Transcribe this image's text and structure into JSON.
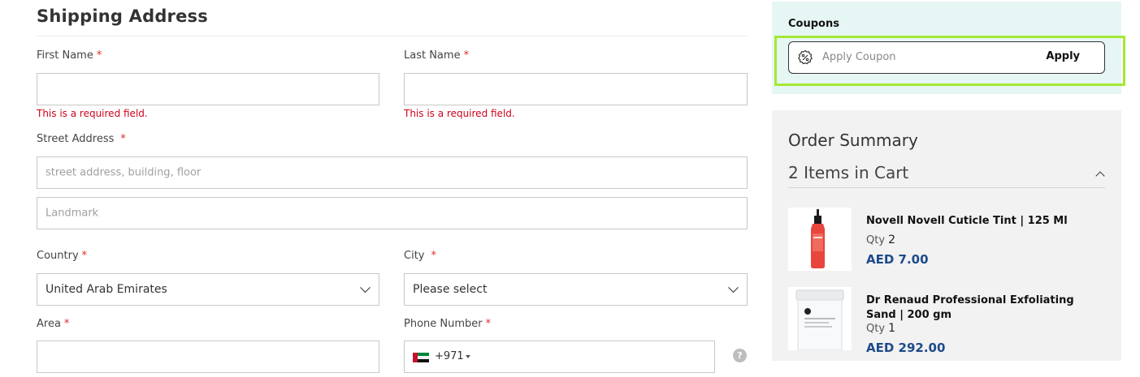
{
  "shipping": {
    "title": "Shipping Address",
    "required_mark": "*",
    "first_name": {
      "label": "First Name",
      "error": "This is a required field."
    },
    "last_name": {
      "label": "Last Name",
      "error": "This is a required field."
    },
    "street": {
      "label": "Street Address",
      "placeholder": "street address, building, floor",
      "landmark_placeholder": "Landmark"
    },
    "country": {
      "label": "Country",
      "value": "United Arab Emirates"
    },
    "city": {
      "label": "City",
      "value": "Please select"
    },
    "area": {
      "label": "Area"
    },
    "phone": {
      "label": "Phone Number",
      "dial_code": "+971",
      "flag": "uae-flag"
    },
    "help_icon": "?"
  },
  "coupons": {
    "title": "Coupons",
    "placeholder": "Apply Coupon",
    "apply_label": "Apply",
    "icon": "discount-badge-icon"
  },
  "summary": {
    "title": "Order Summary",
    "items_count": "2 Items in Cart",
    "qty_label": "Qty",
    "items": [
      {
        "name": "Novell Novell Cuticle Tint | 125 Ml",
        "qty": "2",
        "price": "AED 7.00"
      },
      {
        "name": "Dr Renaud Professional Exfoliating Sand | 200 gm",
        "qty": "1",
        "price": "AED 292.00"
      }
    ]
  },
  "colors": {
    "error": "#d0021b",
    "price": "#1e4b8a",
    "coupon_bg": "#e6f6f5",
    "highlight": "#a5e832"
  }
}
